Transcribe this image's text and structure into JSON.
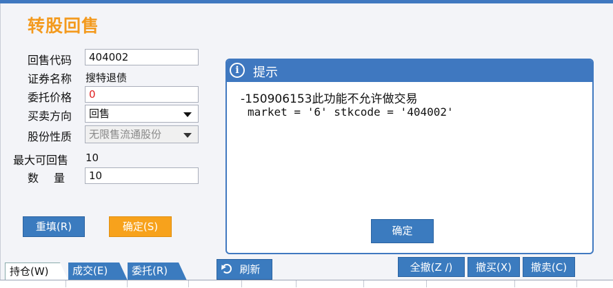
{
  "page": {
    "title": "转股回售"
  },
  "form": {
    "code_label": "回售代码",
    "code_value": "404002",
    "name_label": "证券名称",
    "name_value": "搜特退债",
    "price_label": "委托价格",
    "price_value": "0",
    "direction_label": "买卖方向",
    "direction_value": "回售",
    "share_type_label": "股份性质",
    "share_type_value": "无限售流通股份",
    "max_label": "最大可回售",
    "max_value": "10",
    "qty_label": "数　量",
    "qty_value": "10",
    "reset_label": "重填(R)",
    "confirm_label": "确定(S)"
  },
  "dialog": {
    "title": "提示",
    "message1": "-150906153此功能不允许做交易",
    "message2": "market = '6' stkcode = '404002'",
    "ok_label": "确定"
  },
  "tabs": [
    {
      "label": "持仓(W)"
    },
    {
      "label": "成交(E)"
    },
    {
      "label": "委托(R)"
    }
  ],
  "toolbar": {
    "refresh_label": "刷新",
    "cancel_all_label": "全撤(Z /)",
    "cancel_buy_label": "撤买(X)",
    "cancel_sell_label": "撤卖(C)"
  },
  "colors": {
    "accent": "#3f78c0",
    "title_orange": "#f39a1e",
    "button_orange": "#f7a21c"
  }
}
